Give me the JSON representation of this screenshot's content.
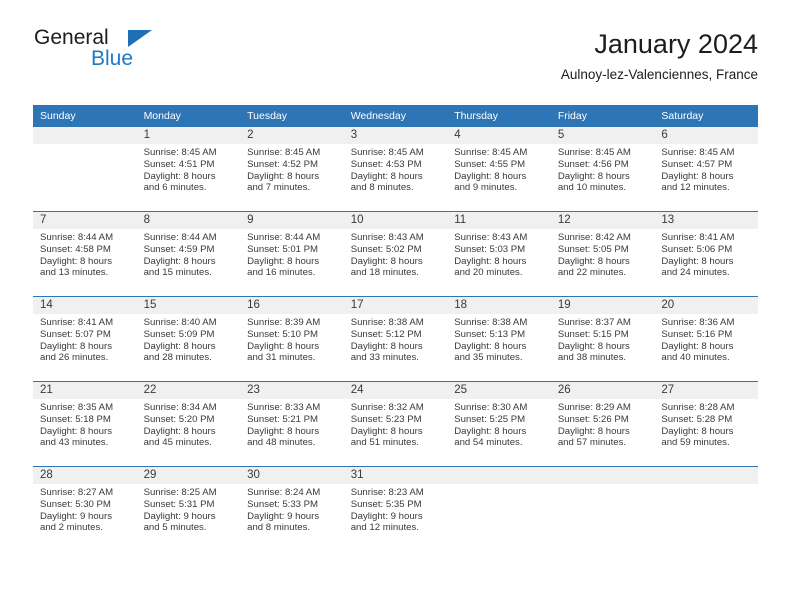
{
  "brand": {
    "name_part1": "General",
    "name_part2": "Blue",
    "triangle_color": "#1f6fb5",
    "blue_text_color": "#2079c7"
  },
  "header": {
    "month_title": "January 2024",
    "location": "Aulnoy-lez-Valenciennes, France"
  },
  "theme": {
    "header_blue": "#2e75b6",
    "daynum_band": "#f0f0f0",
    "text": "#3a3a3a"
  },
  "weekday_headers": [
    "Sunday",
    "Monday",
    "Tuesday",
    "Wednesday",
    "Thursday",
    "Friday",
    "Saturday"
  ],
  "weeks": [
    [
      {
        "day": "",
        "sunrise": "",
        "sunset": "",
        "daylight_line1": "",
        "daylight_line2": ""
      },
      {
        "day": "1",
        "sunrise": "Sunrise: 8:45 AM",
        "sunset": "Sunset: 4:51 PM",
        "daylight_line1": "Daylight: 8 hours",
        "daylight_line2": "and 6 minutes."
      },
      {
        "day": "2",
        "sunrise": "Sunrise: 8:45 AM",
        "sunset": "Sunset: 4:52 PM",
        "daylight_line1": "Daylight: 8 hours",
        "daylight_line2": "and 7 minutes."
      },
      {
        "day": "3",
        "sunrise": "Sunrise: 8:45 AM",
        "sunset": "Sunset: 4:53 PM",
        "daylight_line1": "Daylight: 8 hours",
        "daylight_line2": "and 8 minutes."
      },
      {
        "day": "4",
        "sunrise": "Sunrise: 8:45 AM",
        "sunset": "Sunset: 4:55 PM",
        "daylight_line1": "Daylight: 8 hours",
        "daylight_line2": "and 9 minutes."
      },
      {
        "day": "5",
        "sunrise": "Sunrise: 8:45 AM",
        "sunset": "Sunset: 4:56 PM",
        "daylight_line1": "Daylight: 8 hours",
        "daylight_line2": "and 10 minutes."
      },
      {
        "day": "6",
        "sunrise": "Sunrise: 8:45 AM",
        "sunset": "Sunset: 4:57 PM",
        "daylight_line1": "Daylight: 8 hours",
        "daylight_line2": "and 12 minutes."
      }
    ],
    [
      {
        "day": "7",
        "sunrise": "Sunrise: 8:44 AM",
        "sunset": "Sunset: 4:58 PM",
        "daylight_line1": "Daylight: 8 hours",
        "daylight_line2": "and 13 minutes."
      },
      {
        "day": "8",
        "sunrise": "Sunrise: 8:44 AM",
        "sunset": "Sunset: 4:59 PM",
        "daylight_line1": "Daylight: 8 hours",
        "daylight_line2": "and 15 minutes."
      },
      {
        "day": "9",
        "sunrise": "Sunrise: 8:44 AM",
        "sunset": "Sunset: 5:01 PM",
        "daylight_line1": "Daylight: 8 hours",
        "daylight_line2": "and 16 minutes."
      },
      {
        "day": "10",
        "sunrise": "Sunrise: 8:43 AM",
        "sunset": "Sunset: 5:02 PM",
        "daylight_line1": "Daylight: 8 hours",
        "daylight_line2": "and 18 minutes."
      },
      {
        "day": "11",
        "sunrise": "Sunrise: 8:43 AM",
        "sunset": "Sunset: 5:03 PM",
        "daylight_line1": "Daylight: 8 hours",
        "daylight_line2": "and 20 minutes."
      },
      {
        "day": "12",
        "sunrise": "Sunrise: 8:42 AM",
        "sunset": "Sunset: 5:05 PM",
        "daylight_line1": "Daylight: 8 hours",
        "daylight_line2": "and 22 minutes."
      },
      {
        "day": "13",
        "sunrise": "Sunrise: 8:41 AM",
        "sunset": "Sunset: 5:06 PM",
        "daylight_line1": "Daylight: 8 hours",
        "daylight_line2": "and 24 minutes."
      }
    ],
    [
      {
        "day": "14",
        "sunrise": "Sunrise: 8:41 AM",
        "sunset": "Sunset: 5:07 PM",
        "daylight_line1": "Daylight: 8 hours",
        "daylight_line2": "and 26 minutes."
      },
      {
        "day": "15",
        "sunrise": "Sunrise: 8:40 AM",
        "sunset": "Sunset: 5:09 PM",
        "daylight_line1": "Daylight: 8 hours",
        "daylight_line2": "and 28 minutes."
      },
      {
        "day": "16",
        "sunrise": "Sunrise: 8:39 AM",
        "sunset": "Sunset: 5:10 PM",
        "daylight_line1": "Daylight: 8 hours",
        "daylight_line2": "and 31 minutes."
      },
      {
        "day": "17",
        "sunrise": "Sunrise: 8:38 AM",
        "sunset": "Sunset: 5:12 PM",
        "daylight_line1": "Daylight: 8 hours",
        "daylight_line2": "and 33 minutes."
      },
      {
        "day": "18",
        "sunrise": "Sunrise: 8:38 AM",
        "sunset": "Sunset: 5:13 PM",
        "daylight_line1": "Daylight: 8 hours",
        "daylight_line2": "and 35 minutes."
      },
      {
        "day": "19",
        "sunrise": "Sunrise: 8:37 AM",
        "sunset": "Sunset: 5:15 PM",
        "daylight_line1": "Daylight: 8 hours",
        "daylight_line2": "and 38 minutes."
      },
      {
        "day": "20",
        "sunrise": "Sunrise: 8:36 AM",
        "sunset": "Sunset: 5:16 PM",
        "daylight_line1": "Daylight: 8 hours",
        "daylight_line2": "and 40 minutes."
      }
    ],
    [
      {
        "day": "21",
        "sunrise": "Sunrise: 8:35 AM",
        "sunset": "Sunset: 5:18 PM",
        "daylight_line1": "Daylight: 8 hours",
        "daylight_line2": "and 43 minutes."
      },
      {
        "day": "22",
        "sunrise": "Sunrise: 8:34 AM",
        "sunset": "Sunset: 5:20 PM",
        "daylight_line1": "Daylight: 8 hours",
        "daylight_line2": "and 45 minutes."
      },
      {
        "day": "23",
        "sunrise": "Sunrise: 8:33 AM",
        "sunset": "Sunset: 5:21 PM",
        "daylight_line1": "Daylight: 8 hours",
        "daylight_line2": "and 48 minutes."
      },
      {
        "day": "24",
        "sunrise": "Sunrise: 8:32 AM",
        "sunset": "Sunset: 5:23 PM",
        "daylight_line1": "Daylight: 8 hours",
        "daylight_line2": "and 51 minutes."
      },
      {
        "day": "25",
        "sunrise": "Sunrise: 8:30 AM",
        "sunset": "Sunset: 5:25 PM",
        "daylight_line1": "Daylight: 8 hours",
        "daylight_line2": "and 54 minutes."
      },
      {
        "day": "26",
        "sunrise": "Sunrise: 8:29 AM",
        "sunset": "Sunset: 5:26 PM",
        "daylight_line1": "Daylight: 8 hours",
        "daylight_line2": "and 57 minutes."
      },
      {
        "day": "27",
        "sunrise": "Sunrise: 8:28 AM",
        "sunset": "Sunset: 5:28 PM",
        "daylight_line1": "Daylight: 8 hours",
        "daylight_line2": "and 59 minutes."
      }
    ],
    [
      {
        "day": "28",
        "sunrise": "Sunrise: 8:27 AM",
        "sunset": "Sunset: 5:30 PM",
        "daylight_line1": "Daylight: 9 hours",
        "daylight_line2": "and 2 minutes."
      },
      {
        "day": "29",
        "sunrise": "Sunrise: 8:25 AM",
        "sunset": "Sunset: 5:31 PM",
        "daylight_line1": "Daylight: 9 hours",
        "daylight_line2": "and 5 minutes."
      },
      {
        "day": "30",
        "sunrise": "Sunrise: 8:24 AM",
        "sunset": "Sunset: 5:33 PM",
        "daylight_line1": "Daylight: 9 hours",
        "daylight_line2": "and 8 minutes."
      },
      {
        "day": "31",
        "sunrise": "Sunrise: 8:23 AM",
        "sunset": "Sunset: 5:35 PM",
        "daylight_line1": "Daylight: 9 hours",
        "daylight_line2": "and 12 minutes."
      },
      {
        "day": "",
        "sunrise": "",
        "sunset": "",
        "daylight_line1": "",
        "daylight_line2": ""
      },
      {
        "day": "",
        "sunrise": "",
        "sunset": "",
        "daylight_line1": "",
        "daylight_line2": ""
      },
      {
        "day": "",
        "sunrise": "",
        "sunset": "",
        "daylight_line1": "",
        "daylight_line2": ""
      }
    ]
  ]
}
